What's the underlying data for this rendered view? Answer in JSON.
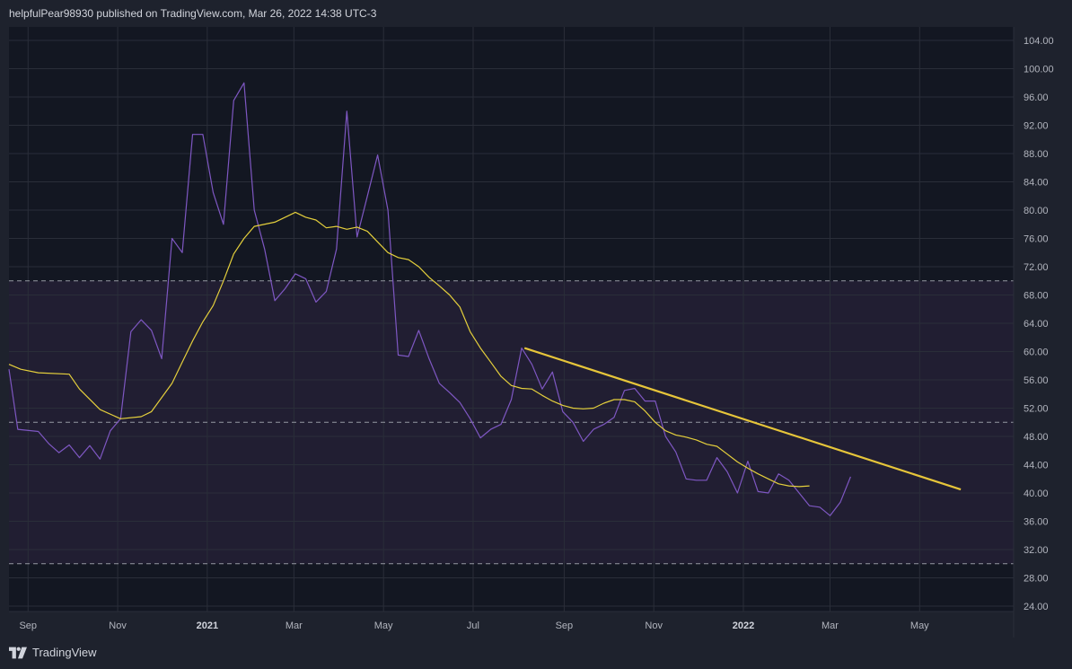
{
  "header": {
    "published_text": "helpfulPear98930 published on TradingView.com, Mar 26, 2022 14:38 UTC-3"
  },
  "footer": {
    "brand": "TradingView",
    "logo_icon": "tradingview-logo-icon"
  },
  "colors": {
    "background": "#1e222d",
    "pane": "#131722",
    "band_fill": "#211e32",
    "price_line": "#7e57c2",
    "ma_line": "#e4cf3c",
    "trendline": "#e6c53a",
    "guide_line": "#9598a1"
  },
  "chart_data": {
    "type": "line",
    "y_axis": {
      "ticks": [
        "104.00",
        "100.00",
        "96.00",
        "92.00",
        "88.00",
        "84.00",
        "80.00",
        "76.00",
        "72.00",
        "68.00",
        "64.00",
        "60.00",
        "56.00",
        "52.00",
        "48.00",
        "44.00",
        "40.00",
        "36.00",
        "32.00",
        "28.00",
        "24.00"
      ],
      "range": [
        24,
        104
      ],
      "position": "right"
    },
    "x_axis": {
      "labels": [
        {
          "text": "Sep",
          "day": 0,
          "bold": false
        },
        {
          "text": "Nov",
          "day": 61,
          "bold": false
        },
        {
          "text": "2021",
          "day": 122,
          "bold": true
        },
        {
          "text": "Mar",
          "day": 181,
          "bold": false
        },
        {
          "text": "May",
          "day": 242,
          "bold": false
        },
        {
          "text": "Jul",
          "day": 303,
          "bold": false
        },
        {
          "text": "Sep",
          "day": 365,
          "bold": false
        },
        {
          "text": "Nov",
          "day": 426,
          "bold": false
        },
        {
          "text": "2022",
          "day": 487,
          "bold": true
        },
        {
          "text": "Mar",
          "day": 546,
          "bold": false
        },
        {
          "text": "May",
          "day": 607,
          "bold": false
        }
      ],
      "range": [
        -13,
        671
      ]
    },
    "horizontal_levels": [
      70,
      50,
      30
    ],
    "band": [
      30,
      70
    ],
    "grid": true,
    "series": [
      {
        "role": "price",
        "points": [
          [
            -13,
            57.5
          ],
          [
            -7,
            49
          ],
          [
            7,
            48.7
          ],
          [
            14,
            47
          ],
          [
            21,
            45.7
          ],
          [
            28,
            46.8
          ],
          [
            35,
            45
          ],
          [
            42,
            46.7
          ],
          [
            49,
            44.8
          ],
          [
            56,
            48.8
          ],
          [
            63,
            50.5
          ],
          [
            70,
            62.8
          ],
          [
            77,
            64.5
          ],
          [
            84,
            63
          ],
          [
            91,
            59
          ],
          [
            98,
            76
          ],
          [
            105,
            74
          ],
          [
            112,
            90.7
          ],
          [
            119,
            90.7
          ],
          [
            126,
            82.5
          ],
          [
            133,
            78
          ],
          [
            140,
            95.5
          ],
          [
            147,
            98
          ],
          [
            154,
            80
          ],
          [
            161,
            74.5
          ],
          [
            168,
            67.2
          ],
          [
            175,
            68.9
          ],
          [
            182,
            71
          ],
          [
            189,
            70.3
          ],
          [
            196,
            67
          ],
          [
            203,
            68.5
          ],
          [
            210,
            74.5
          ],
          [
            217,
            94
          ],
          [
            224,
            76.2
          ],
          [
            231,
            82
          ],
          [
            238,
            87.8
          ],
          [
            245,
            80
          ],
          [
            252,
            59.5
          ],
          [
            259,
            59.3
          ],
          [
            266,
            63
          ],
          [
            273,
            59
          ],
          [
            280,
            55.5
          ],
          [
            287,
            54.2
          ],
          [
            294,
            52.8
          ],
          [
            301,
            50.5
          ],
          [
            308,
            47.8
          ],
          [
            315,
            49
          ],
          [
            322,
            49.7
          ],
          [
            329,
            53.2
          ],
          [
            336,
            60.5
          ],
          [
            343,
            58.2
          ],
          [
            350,
            54.7
          ],
          [
            357,
            57.1
          ],
          [
            364,
            51.5
          ],
          [
            371,
            50
          ],
          [
            378,
            47.3
          ],
          [
            385,
            49
          ],
          [
            392,
            49.7
          ],
          [
            399,
            50.7
          ],
          [
            406,
            54.5
          ],
          [
            413,
            54.8
          ],
          [
            420,
            53
          ],
          [
            427,
            53
          ],
          [
            434,
            48
          ],
          [
            441,
            45.8
          ],
          [
            448,
            42
          ],
          [
            455,
            41.8
          ],
          [
            462,
            41.8
          ],
          [
            469,
            45
          ],
          [
            476,
            43
          ],
          [
            483,
            40
          ],
          [
            490,
            44.5
          ],
          [
            497,
            40.2
          ],
          [
            504,
            40
          ],
          [
            511,
            42.7
          ],
          [
            518,
            41.8
          ],
          [
            525,
            40
          ],
          [
            532,
            38.2
          ],
          [
            539,
            38
          ],
          [
            546,
            36.8
          ],
          [
            553,
            38.7
          ],
          [
            560,
            42.3
          ]
        ]
      },
      {
        "role": "moving_average",
        "points": [
          [
            -13,
            58.2
          ],
          [
            -5,
            57.5
          ],
          [
            7,
            57
          ],
          [
            28,
            56.8
          ],
          [
            35,
            54.7
          ],
          [
            49,
            51.8
          ],
          [
            63,
            50.5
          ],
          [
            77,
            50.8
          ],
          [
            84,
            51.5
          ],
          [
            98,
            55.5
          ],
          [
            105,
            58.5
          ],
          [
            112,
            61.5
          ],
          [
            119,
            64.2
          ],
          [
            126,
            66.5
          ],
          [
            133,
            70
          ],
          [
            140,
            73.8
          ],
          [
            147,
            76
          ],
          [
            154,
            77.7
          ],
          [
            168,
            78.3
          ],
          [
            175,
            79
          ],
          [
            182,
            79.7
          ],
          [
            189,
            79
          ],
          [
            196,
            78.6
          ],
          [
            203,
            77.5
          ],
          [
            210,
            77.7
          ],
          [
            217,
            77.3
          ],
          [
            224,
            77.6
          ],
          [
            231,
            77
          ],
          [
            238,
            75.5
          ],
          [
            245,
            74
          ],
          [
            252,
            73.3
          ],
          [
            259,
            73
          ],
          [
            266,
            72
          ],
          [
            273,
            70.5
          ],
          [
            280,
            69.3
          ],
          [
            287,
            68
          ],
          [
            294,
            66.3
          ],
          [
            301,
            62.8
          ],
          [
            308,
            60.5
          ],
          [
            315,
            58.5
          ],
          [
            322,
            56.5
          ],
          [
            329,
            55.2
          ],
          [
            336,
            54.8
          ],
          [
            343,
            54.7
          ],
          [
            350,
            53.8
          ],
          [
            357,
            53
          ],
          [
            364,
            52.4
          ],
          [
            371,
            52
          ],
          [
            378,
            51.9
          ],
          [
            385,
            52
          ],
          [
            392,
            52.7
          ],
          [
            399,
            53.2
          ],
          [
            406,
            53.2
          ],
          [
            413,
            52.9
          ],
          [
            420,
            51.6
          ],
          [
            427,
            50
          ],
          [
            434,
            48.8
          ],
          [
            441,
            48.2
          ],
          [
            448,
            47.9
          ],
          [
            455,
            47.5
          ],
          [
            462,
            46.9
          ],
          [
            469,
            46.6
          ],
          [
            476,
            45.5
          ],
          [
            483,
            44.4
          ],
          [
            490,
            43.5
          ],
          [
            497,
            42.7
          ],
          [
            504,
            42
          ],
          [
            511,
            41.3
          ],
          [
            518,
            41
          ],
          [
            525,
            40.9
          ],
          [
            532,
            41
          ]
        ]
      },
      {
        "role": "trendline",
        "points": [
          [
            338,
            60.5
          ],
          [
            635,
            40.5
          ]
        ]
      }
    ]
  }
}
